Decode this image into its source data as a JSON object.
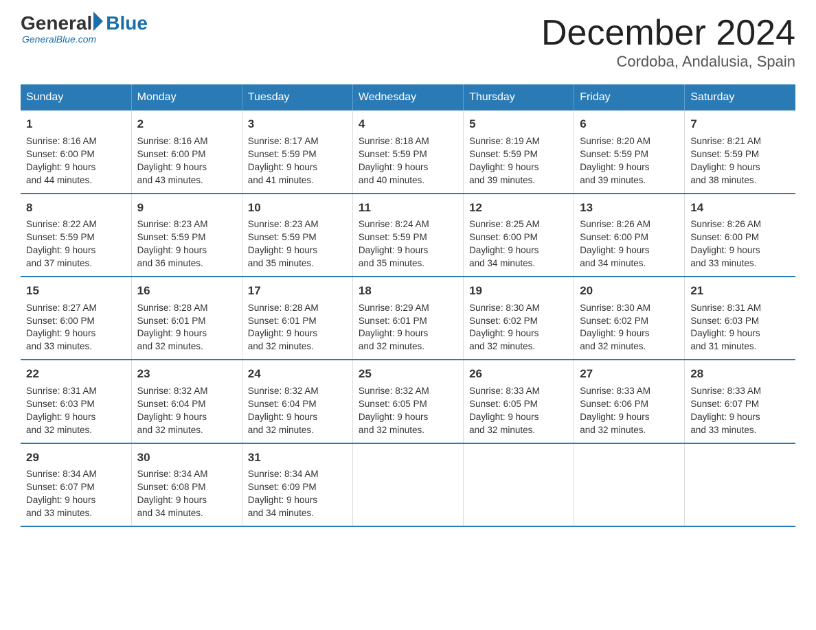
{
  "logo": {
    "general": "General",
    "blue": "Blue",
    "subtitle": "GeneralBlue.com"
  },
  "title": "December 2024",
  "subtitle": "Cordoba, Andalusia, Spain",
  "headers": [
    "Sunday",
    "Monday",
    "Tuesday",
    "Wednesday",
    "Thursday",
    "Friday",
    "Saturday"
  ],
  "weeks": [
    [
      {
        "day": "1",
        "info": "Sunrise: 8:16 AM\nSunset: 6:00 PM\nDaylight: 9 hours\nand 44 minutes."
      },
      {
        "day": "2",
        "info": "Sunrise: 8:16 AM\nSunset: 6:00 PM\nDaylight: 9 hours\nand 43 minutes."
      },
      {
        "day": "3",
        "info": "Sunrise: 8:17 AM\nSunset: 5:59 PM\nDaylight: 9 hours\nand 41 minutes."
      },
      {
        "day": "4",
        "info": "Sunrise: 8:18 AM\nSunset: 5:59 PM\nDaylight: 9 hours\nand 40 minutes."
      },
      {
        "day": "5",
        "info": "Sunrise: 8:19 AM\nSunset: 5:59 PM\nDaylight: 9 hours\nand 39 minutes."
      },
      {
        "day": "6",
        "info": "Sunrise: 8:20 AM\nSunset: 5:59 PM\nDaylight: 9 hours\nand 39 minutes."
      },
      {
        "day": "7",
        "info": "Sunrise: 8:21 AM\nSunset: 5:59 PM\nDaylight: 9 hours\nand 38 minutes."
      }
    ],
    [
      {
        "day": "8",
        "info": "Sunrise: 8:22 AM\nSunset: 5:59 PM\nDaylight: 9 hours\nand 37 minutes."
      },
      {
        "day": "9",
        "info": "Sunrise: 8:23 AM\nSunset: 5:59 PM\nDaylight: 9 hours\nand 36 minutes."
      },
      {
        "day": "10",
        "info": "Sunrise: 8:23 AM\nSunset: 5:59 PM\nDaylight: 9 hours\nand 35 minutes."
      },
      {
        "day": "11",
        "info": "Sunrise: 8:24 AM\nSunset: 5:59 PM\nDaylight: 9 hours\nand 35 minutes."
      },
      {
        "day": "12",
        "info": "Sunrise: 8:25 AM\nSunset: 6:00 PM\nDaylight: 9 hours\nand 34 minutes."
      },
      {
        "day": "13",
        "info": "Sunrise: 8:26 AM\nSunset: 6:00 PM\nDaylight: 9 hours\nand 34 minutes."
      },
      {
        "day": "14",
        "info": "Sunrise: 8:26 AM\nSunset: 6:00 PM\nDaylight: 9 hours\nand 33 minutes."
      }
    ],
    [
      {
        "day": "15",
        "info": "Sunrise: 8:27 AM\nSunset: 6:00 PM\nDaylight: 9 hours\nand 33 minutes."
      },
      {
        "day": "16",
        "info": "Sunrise: 8:28 AM\nSunset: 6:01 PM\nDaylight: 9 hours\nand 32 minutes."
      },
      {
        "day": "17",
        "info": "Sunrise: 8:28 AM\nSunset: 6:01 PM\nDaylight: 9 hours\nand 32 minutes."
      },
      {
        "day": "18",
        "info": "Sunrise: 8:29 AM\nSunset: 6:01 PM\nDaylight: 9 hours\nand 32 minutes."
      },
      {
        "day": "19",
        "info": "Sunrise: 8:30 AM\nSunset: 6:02 PM\nDaylight: 9 hours\nand 32 minutes."
      },
      {
        "day": "20",
        "info": "Sunrise: 8:30 AM\nSunset: 6:02 PM\nDaylight: 9 hours\nand 32 minutes."
      },
      {
        "day": "21",
        "info": "Sunrise: 8:31 AM\nSunset: 6:03 PM\nDaylight: 9 hours\nand 31 minutes."
      }
    ],
    [
      {
        "day": "22",
        "info": "Sunrise: 8:31 AM\nSunset: 6:03 PM\nDaylight: 9 hours\nand 32 minutes."
      },
      {
        "day": "23",
        "info": "Sunrise: 8:32 AM\nSunset: 6:04 PM\nDaylight: 9 hours\nand 32 minutes."
      },
      {
        "day": "24",
        "info": "Sunrise: 8:32 AM\nSunset: 6:04 PM\nDaylight: 9 hours\nand 32 minutes."
      },
      {
        "day": "25",
        "info": "Sunrise: 8:32 AM\nSunset: 6:05 PM\nDaylight: 9 hours\nand 32 minutes."
      },
      {
        "day": "26",
        "info": "Sunrise: 8:33 AM\nSunset: 6:05 PM\nDaylight: 9 hours\nand 32 minutes."
      },
      {
        "day": "27",
        "info": "Sunrise: 8:33 AM\nSunset: 6:06 PM\nDaylight: 9 hours\nand 32 minutes."
      },
      {
        "day": "28",
        "info": "Sunrise: 8:33 AM\nSunset: 6:07 PM\nDaylight: 9 hours\nand 33 minutes."
      }
    ],
    [
      {
        "day": "29",
        "info": "Sunrise: 8:34 AM\nSunset: 6:07 PM\nDaylight: 9 hours\nand 33 minutes."
      },
      {
        "day": "30",
        "info": "Sunrise: 8:34 AM\nSunset: 6:08 PM\nDaylight: 9 hours\nand 34 minutes."
      },
      {
        "day": "31",
        "info": "Sunrise: 8:34 AM\nSunset: 6:09 PM\nDaylight: 9 hours\nand 34 minutes."
      },
      {
        "day": "",
        "info": ""
      },
      {
        "day": "",
        "info": ""
      },
      {
        "day": "",
        "info": ""
      },
      {
        "day": "",
        "info": ""
      }
    ]
  ]
}
